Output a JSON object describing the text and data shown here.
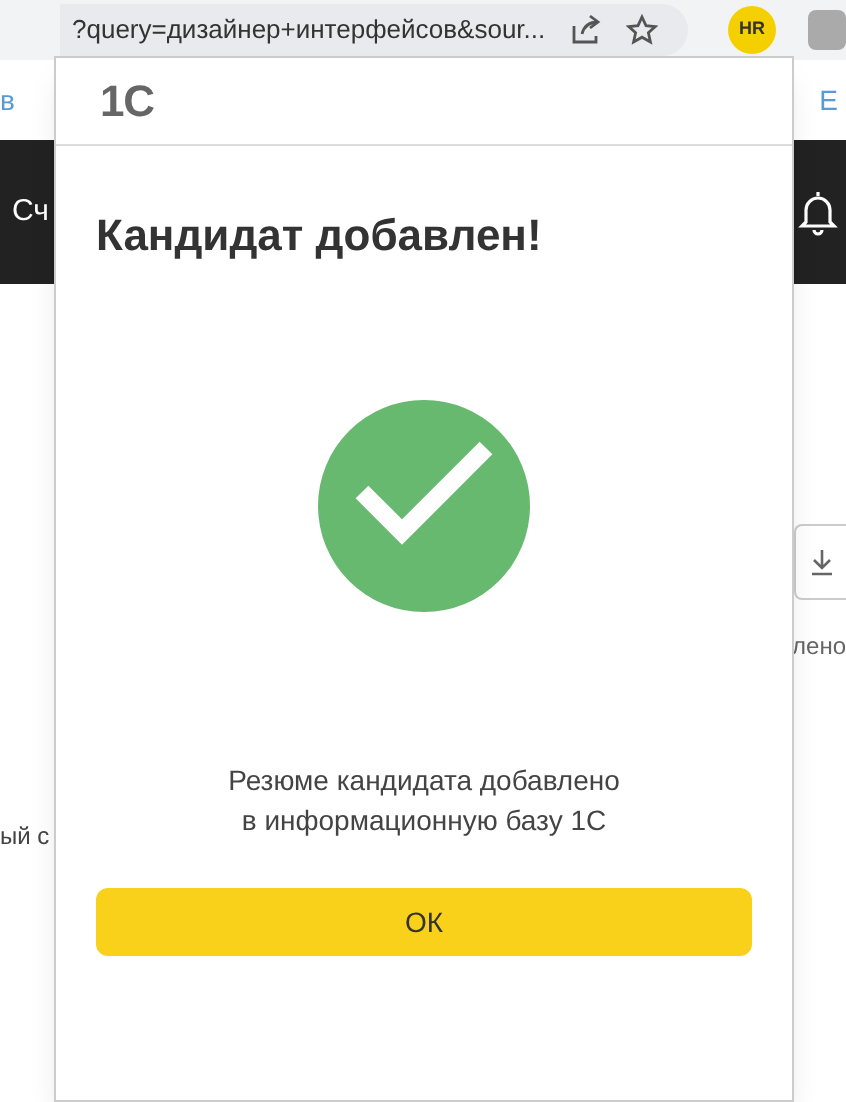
{
  "browser": {
    "address": "?query=дизайнер+интерфейсов&sour...",
    "extension_label": "HR"
  },
  "background_page": {
    "link_left": "в",
    "link_right": "Е",
    "nav_text": "Сч",
    "status_text": "лено",
    "text_left": "ый с"
  },
  "popup": {
    "logo": "1С",
    "title": "Кандидат добавлен!",
    "message_lines": [
      "Резюме кандидата добавлено",
      "в информационную базу 1С"
    ],
    "button": "ОК"
  }
}
